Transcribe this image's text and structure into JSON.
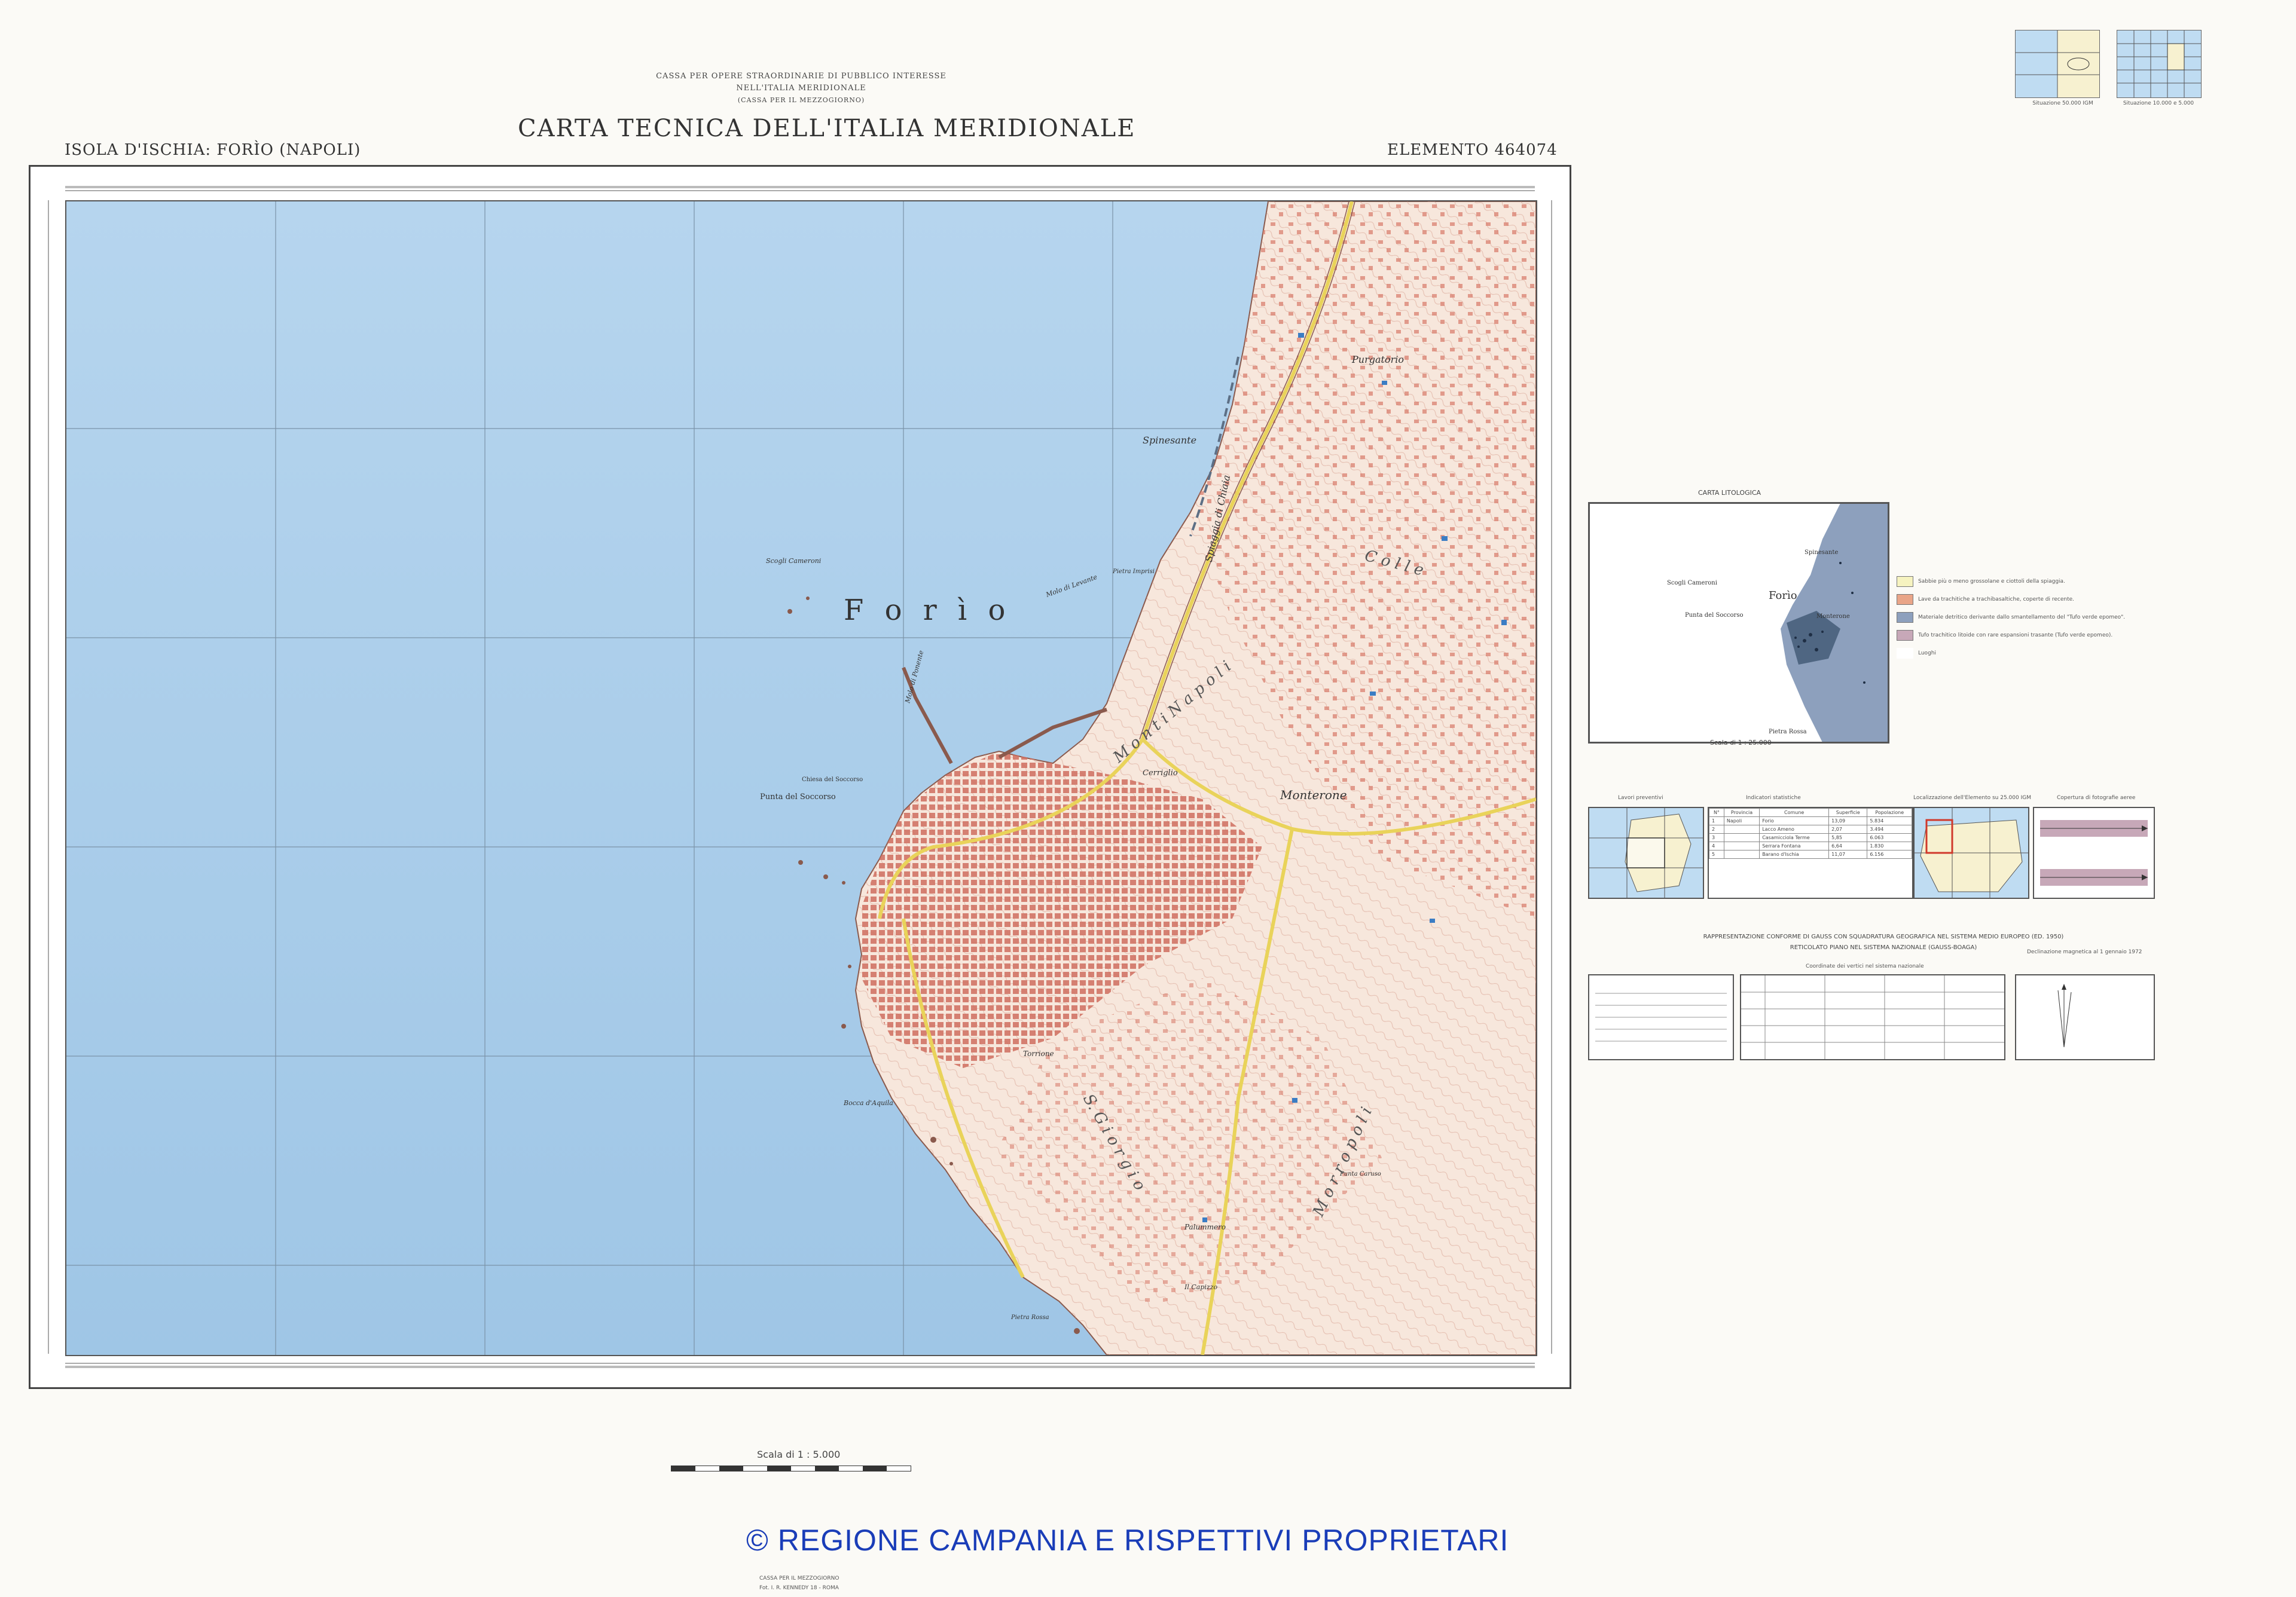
{
  "header": {
    "org_line1": "CASSA PER OPERE STRAORDINARIE DI PUBBLICO INTERESSE",
    "org_line2": "NELL'ITALIA MERIDIONALE",
    "org_line3": "(CASSA PER IL MEZZOGIORNO)",
    "title": "CARTA TECNICA DELL'ITALIA MERIDIONALE",
    "sheet_name": "ISOLA D'ISCHIA: FORÌO (NAPOLI)",
    "element_label": "ELEMENTO",
    "element_number": "464074"
  },
  "index_maps": {
    "caption_left": "Situazione 50.000 IGM",
    "caption_right": "Situazione 10.000 e 5.000"
  },
  "map": {
    "town_label": "F o r ì o",
    "places": [
      "Purgatorio",
      "Spinesante",
      "Scogli Cameroni",
      "Punta del Soccorso",
      "Monterone",
      "Cerriglio",
      "Torrione",
      "Bocca d'Aquila",
      "Spiaggia di Chiaia",
      "Molo di Levante",
      "Molo di Ponente",
      "Pietra Imprisi",
      "Palummero",
      "Pietra Rossa",
      "Il Capizzo",
      "Chiesa del Soccorso",
      "Punta Caruso"
    ],
    "lettered_ridges": [
      "M o n t i   N a p o l i",
      "M o r r o p o l i",
      "S. G i o r g i o",
      "C o l l e"
    ]
  },
  "litho": {
    "title": "CARTA LITOLOGICA",
    "scale": "Scala di 1 : 25.000",
    "places": [
      "Spinesante",
      "Scogli Cameroni",
      "Forìo",
      "Punta del Soccorso",
      "Monterone",
      "Pietra Rossa"
    ],
    "legend": [
      {
        "color": "#f6f3c0",
        "text": "Sabbie più o meno grossolane e ciottoli della spiaggia."
      },
      {
        "color": "#e9a588",
        "text": "Lave da trachitiche a trachibasaltiche, coperte di recente."
      },
      {
        "color": "#8da0bd",
        "text": "Materiale detritico derivante dallo smantellamento del \"Tufo verde epomeo\"."
      },
      {
        "color": "#c7a8b8",
        "text": "Tufo trachitico litoide con rare espansioni trasante (Tufo verde epomeo)."
      },
      {
        "color": "#ffffff",
        "text": "Luoghi"
      }
    ]
  },
  "panels": {
    "adjacent_title": "Lavori preventivi",
    "stats_title": "Indicatori statistiche",
    "location_title": "Localizzazione dell'Elemento su 25.000 IGM",
    "photo_title": "Copertura di fotografie aeree",
    "stats_headers": [
      "N°",
      "Provincia",
      "Comune",
      "Superficie",
      "Popolazione"
    ],
    "stats_rows": [
      [
        "1",
        "Napoli",
        "Forio",
        "13,09",
        "5.834"
      ],
      [
        "2",
        "",
        "Lacco Ameno",
        "2,07",
        "3.494"
      ],
      [
        "3",
        "",
        "Casamicciola Terme",
        "5,85",
        "6.063"
      ],
      [
        "4",
        "",
        "Serrara Fontana",
        "6,64",
        "1.830"
      ],
      [
        "5",
        "",
        "Barano d'Ischia",
        "11,07",
        "6.156"
      ]
    ]
  },
  "projection": {
    "line1": "RAPPRESENTAZIONE CONFORME DI GAUSS CON SQUADRATURA GEOGRAFICA NEL SISTEMA MEDIO EUROPEO (ED. 1950)",
    "line2": "RETICOLATO PIANO NEL SISTEMA NAZIONALE (GAUSS-BOAGA)",
    "coord_title": "Coordinate dei vertici nel sistema nazionale",
    "decl_title": "Declinazione magnetica al 1 gennaio 1972"
  },
  "footer": {
    "scale_label": "Scala di 1 : 5.000",
    "copyright": "© REGIONE CAMPANIA E RISPETTIVI PROPRIETARI",
    "publisher_line1": "CASSA PER IL MEZZOGIORNO",
    "publisher_line2": "Fot. I. R. KENNEDY 18 - ROMA"
  },
  "colors": {
    "sea": "#a9cde9",
    "land": "#f7e9df",
    "building": "#d87a6a",
    "road": "#f2e36b",
    "contour": "#c58a78",
    "copyright": "#1a3db8"
  }
}
